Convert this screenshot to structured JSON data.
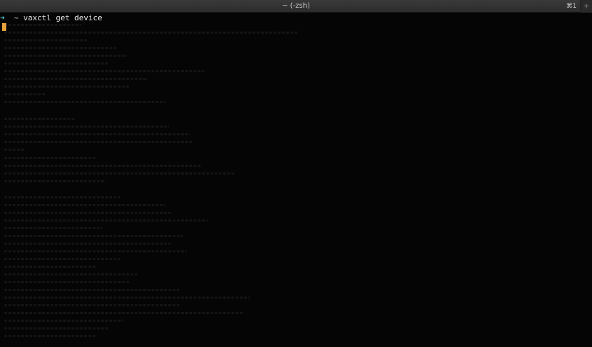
{
  "window": {
    "title": "~ (-zsh)",
    "shortcut": "⌘1",
    "new_tab_symbol": "+"
  },
  "terminal": {
    "prompt_symbol": "➜",
    "cwd": "~",
    "command": "vaxctl get device"
  },
  "colors": {
    "background": "#050505",
    "prompt": "#4fd1d9",
    "cursor": "#e8a33a"
  }
}
